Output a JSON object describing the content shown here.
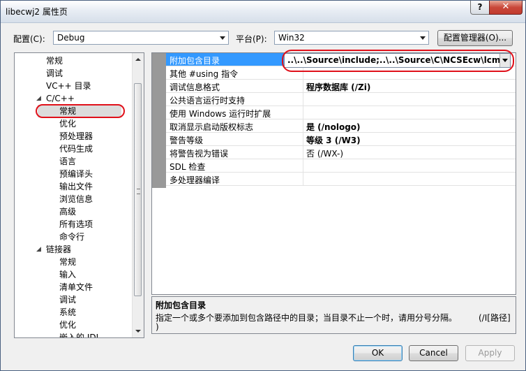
{
  "window": {
    "title": "libecwj2 属性页",
    "help_label": "?",
    "close_label": "✕"
  },
  "toolbar": {
    "config_label": "配置(C):",
    "config_value": "Debug",
    "platform_label": "平台(P):",
    "platform_value": "Win32",
    "config_manager_label": "配置管理器(O)..."
  },
  "tree": {
    "items": [
      {
        "label": "常规",
        "level": 1
      },
      {
        "label": "调试",
        "level": 1
      },
      {
        "label": "VC++ 目录",
        "level": 1
      },
      {
        "label": "C/C++",
        "level": 0,
        "expander": "◢"
      },
      {
        "label": "常规",
        "level": 2,
        "selected": true
      },
      {
        "label": "优化",
        "level": 2
      },
      {
        "label": "预处理器",
        "level": 2
      },
      {
        "label": "代码生成",
        "level": 2
      },
      {
        "label": "语言",
        "level": 2
      },
      {
        "label": "预编译头",
        "level": 2
      },
      {
        "label": "输出文件",
        "level": 2
      },
      {
        "label": "浏览信息",
        "level": 2
      },
      {
        "label": "高级",
        "level": 2
      },
      {
        "label": "所有选项",
        "level": 2
      },
      {
        "label": "命令行",
        "level": 2
      },
      {
        "label": "链接器",
        "level": 0,
        "expander": "◢"
      },
      {
        "label": "常规",
        "level": 2
      },
      {
        "label": "输入",
        "level": 2
      },
      {
        "label": "清单文件",
        "level": 2
      },
      {
        "label": "调试",
        "level": 2
      },
      {
        "label": "系统",
        "level": 2
      },
      {
        "label": "优化",
        "level": 2
      },
      {
        "label": "嵌入的 IDL",
        "level": 2
      }
    ]
  },
  "properties": {
    "rows": [
      {
        "name": "附加包含目录",
        "value": "..\\..\\Source\\include;..\\..\\Source\\C\\NCSEcw\\lcms\\includ",
        "bold": true,
        "active": true
      },
      {
        "name": "其他 #using 指令",
        "value": ""
      },
      {
        "name": "调试信息格式",
        "value": "程序数据库 (/Zi)",
        "bold": true
      },
      {
        "name": "公共语言运行时支持",
        "value": ""
      },
      {
        "name": "使用 Windows 运行时扩展",
        "value": ""
      },
      {
        "name": "取消显示启动版权标志",
        "value": "是 (/nologo)",
        "bold": true
      },
      {
        "name": "警告等级",
        "value": "等级 3 (/W3)",
        "bold": true
      },
      {
        "name": "将警告视为错误",
        "value": "否 (/WX-)"
      },
      {
        "name": "SDL 检查",
        "value": ""
      },
      {
        "name": "多处理器编译",
        "value": ""
      }
    ]
  },
  "description": {
    "title": "附加包含目录",
    "text": "指定一个或多个要添加到包含路径中的目录；当目录不止一个时，请用分号分隔。",
    "switch": "(/I[路径]",
    "switch_end": ")"
  },
  "buttons": {
    "ok": "OK",
    "cancel": "Cancel",
    "apply": "Apply"
  },
  "colors": {
    "highlight": "#3399ff",
    "annotation": "#e0101a"
  }
}
